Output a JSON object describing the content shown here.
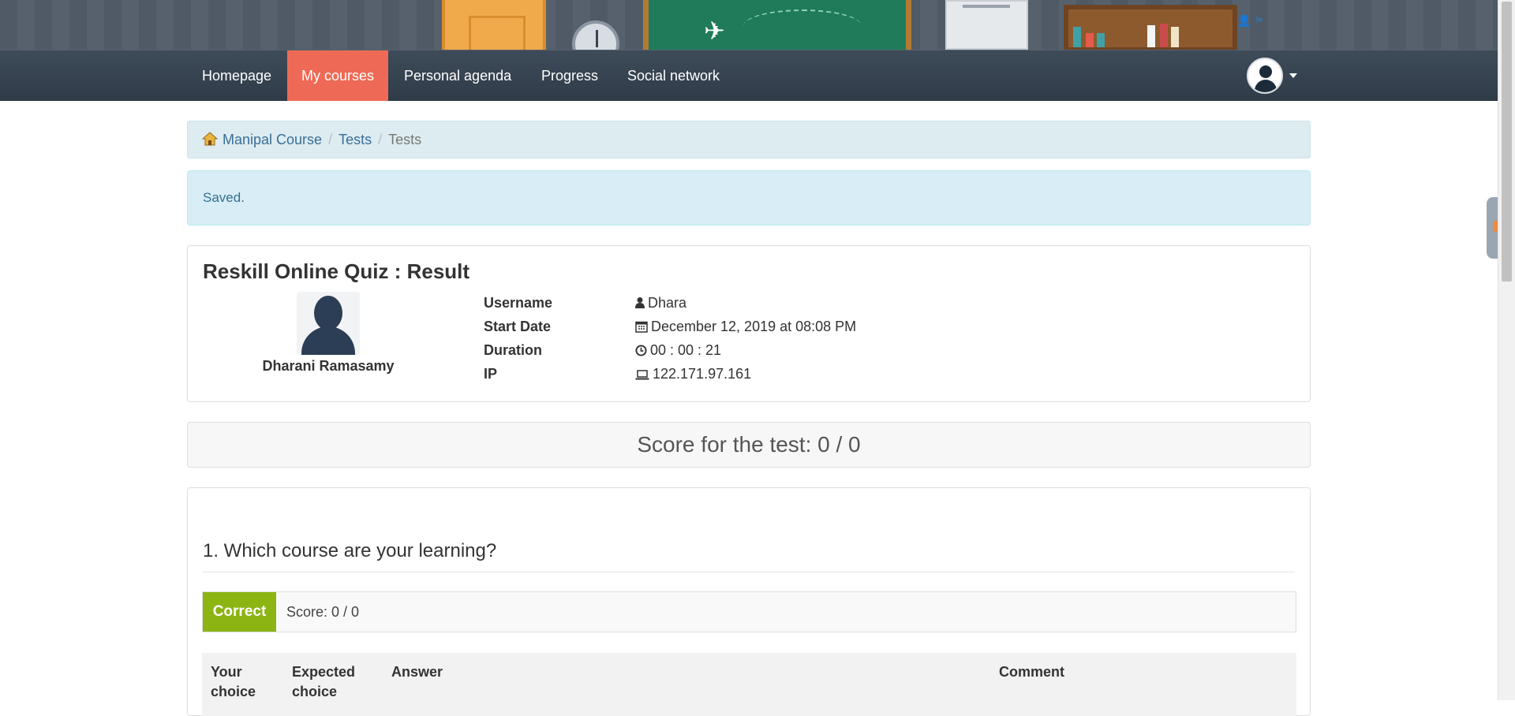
{
  "nav": {
    "items": [
      {
        "label": "Homepage",
        "active": false
      },
      {
        "label": "My courses",
        "active": true
      },
      {
        "label": "Personal agenda",
        "active": false
      },
      {
        "label": "Progress",
        "active": false
      },
      {
        "label": "Social network",
        "active": false
      }
    ],
    "active_color": "#ef6a56"
  },
  "breadcrumb": {
    "items": [
      "Manipal Course",
      "Tests"
    ],
    "current": "Tests"
  },
  "alert": {
    "message": "Saved."
  },
  "result": {
    "title": "Reskill Online Quiz : Result",
    "user_fullname": "Dharani Ramasamy",
    "fields": [
      {
        "label": "Username",
        "icon": "user-icon",
        "value": "Dhara"
      },
      {
        "label": "Start Date",
        "icon": "calendar-icon",
        "value": "December 12, 2019 at 08:08 PM"
      },
      {
        "label": "Duration",
        "icon": "clock-icon",
        "value": "00 : 00 : 21"
      },
      {
        "label": "IP",
        "icon": "laptop-icon",
        "value": "122.171.97.161"
      }
    ]
  },
  "score": {
    "text": "Score for the test: 0 / 0"
  },
  "question": {
    "title": "1. Which course are your learning?",
    "status": "Correct",
    "status_color": "#8cb413",
    "score": "Score: 0 / 0",
    "columns": [
      "Your choice",
      "Expected choice",
      "Answer",
      "Comment"
    ]
  }
}
